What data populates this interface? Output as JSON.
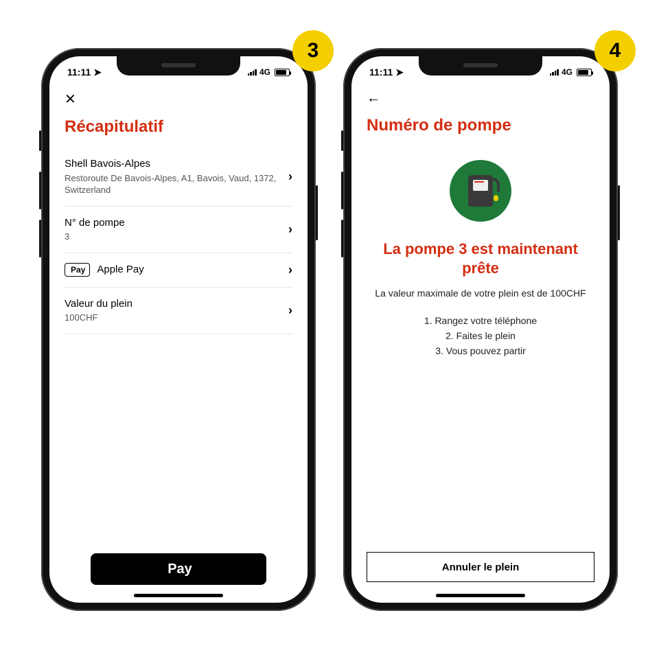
{
  "badges": {
    "left": "3",
    "right": "4"
  },
  "status": {
    "time": "11:11",
    "network": "4G"
  },
  "screenA": {
    "title": "Récapitulatif",
    "rows": {
      "station": {
        "title": "Shell Bavois-Alpes",
        "sub": "Restoroute De Bavois-Alpes, A1, Bavois, Vaud, 1372, Switzerland"
      },
      "pump": {
        "title": "N° de pompe",
        "sub": "3"
      },
      "payment": {
        "label": "Apple Pay",
        "chip": "Pay"
      },
      "amount": {
        "title": "Valeur du plein",
        "sub": "100CHF"
      }
    },
    "pay_button": "Pay"
  },
  "screenB": {
    "title": "Numéro de pompe",
    "ready_title": "La pompe 3 est maintenant prête",
    "ready_sub": "La valeur maximale de votre plein est de 100CHF",
    "steps": {
      "s1": "1. Rangez votre téléphone",
      "s2": "2. Faites le plein",
      "s3": "3. Vous pouvez partir"
    },
    "cancel": "Annuler le plein"
  }
}
